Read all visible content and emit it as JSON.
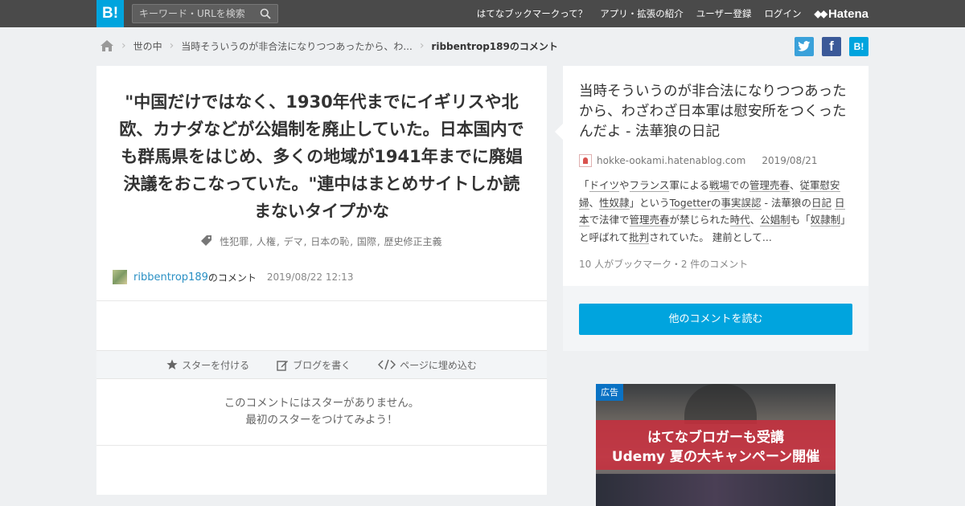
{
  "header": {
    "logo": "B!",
    "search_placeholder": "キーワード・URLを検索",
    "nav": [
      "はてなブックマークって？",
      "アプリ・拡張の紹介",
      "ユーザー登録",
      "ログイン"
    ],
    "brand": "Hatena"
  },
  "breadcrumb": {
    "category": "世の中",
    "entry": "当時そういうのが非合法になりつつあったから、わ...",
    "current": "ribbentrop189のコメント"
  },
  "share": {
    "twitter": "t",
    "facebook": "f",
    "hatebu": "B!"
  },
  "comment": {
    "text": "\"中国だけではなく、1930年代までにイギリスや北欧、カナダなどが公娼制を廃止していた。日本国内でも群馬県をはじめ、多くの地域が1941年までに廃娼決議をおこなっていた。\"連中はまとめサイトしか読まないタイプかな",
    "tags": [
      "性犯罪",
      "人権",
      "デマ",
      "日本の恥",
      "国際",
      "歴史修正主義"
    ],
    "username": "ribbentrop189",
    "username_suffix": "のコメント",
    "timestamp": "2019/08/22 12:13"
  },
  "actions": {
    "star": "スターを付ける",
    "blog": "ブログを書く",
    "embed": "ページに埋め込む"
  },
  "no_star": {
    "line1": "このコメントにはスターがありません。",
    "line2": "最初のスターをつけてみよう！"
  },
  "entry": {
    "title": "当時そういうのが非合法になりつつあったから、わざわざ日本軍は慰安所をつくったんだよ - 法華狼の日記",
    "domain": "hokke-ookami.hatenablog.com",
    "date": "2019/08/21",
    "excerpt": [
      {
        "t": "「",
        "u": false
      },
      {
        "t": "ドイツ",
        "u": true
      },
      {
        "t": "や",
        "u": false
      },
      {
        "t": "フランス",
        "u": true
      },
      {
        "t": "軍による",
        "u": false
      },
      {
        "t": "戦場",
        "u": true
      },
      {
        "t": "での",
        "u": false
      },
      {
        "t": "管理売春",
        "u": true
      },
      {
        "t": "、",
        "u": false
      },
      {
        "t": "従軍慰安婦",
        "u": true
      },
      {
        "t": "、",
        "u": false
      },
      {
        "t": "性奴隷",
        "u": true
      },
      {
        "t": "」という",
        "u": false
      },
      {
        "t": "Togetter",
        "u": true
      },
      {
        "t": "の",
        "u": false
      },
      {
        "t": "事実誤認",
        "u": true
      },
      {
        "t": " - 法華狼の",
        "u": false
      },
      {
        "t": "日記",
        "u": true
      },
      {
        "t": " ",
        "u": false
      },
      {
        "t": "日本",
        "u": true
      },
      {
        "t": "で法律で",
        "u": false
      },
      {
        "t": "管理売春",
        "u": true
      },
      {
        "t": "が禁じられた",
        "u": false
      },
      {
        "t": "時代",
        "u": true
      },
      {
        "t": "、",
        "u": false
      },
      {
        "t": "公娼制",
        "u": true
      },
      {
        "t": "も「",
        "u": false
      },
      {
        "t": "奴隷制",
        "u": true
      },
      {
        "t": "」と呼ばれて",
        "u": false
      },
      {
        "t": "批判",
        "u": true
      },
      {
        "t": "されていた。 建前として...",
        "u": false
      }
    ],
    "counts": "10 人がブックマーク・2 件のコメント",
    "read_more": "他のコメントを読む"
  },
  "ad": {
    "label": "広告",
    "line1": "はてなブロガーも受講",
    "line2": "Udemy 夏の大キャンペーン開催"
  },
  "colors": {
    "accent": "#00a4de",
    "header": "#4a4a4a",
    "link": "#2a90c4"
  }
}
